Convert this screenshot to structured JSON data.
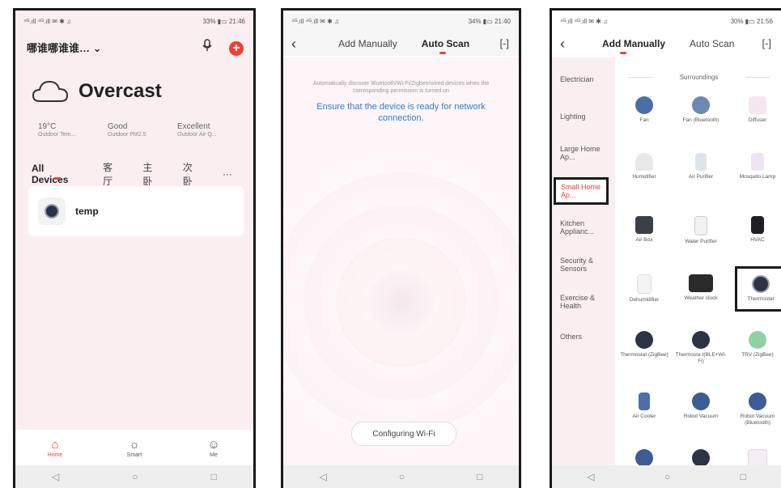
{
  "phone1": {
    "status_left": "⁴ᴳ.ıll ⁴ᴳ.ıll ✉ ✱ ♫",
    "status_right": "33% ▮▭ 21:46",
    "home_name": "哪谁哪谁谁… ⌄",
    "add_icon": "+",
    "weather": "Overcast",
    "stats": [
      {
        "value": "19°C",
        "label": "Outdoor Tem..."
      },
      {
        "value": "Good",
        "label": "Outdoor PM2.5"
      },
      {
        "value": "Excellent",
        "label": "Outdoor Air Q..."
      }
    ],
    "rooms": [
      "All Devices",
      "客厅",
      "主卧",
      "次卧",
      "···"
    ],
    "device_name": "temp",
    "tabs": [
      {
        "label": "Home",
        "icon": "⌂"
      },
      {
        "label": "Smart",
        "icon": "☼"
      },
      {
        "label": "Me",
        "icon": "☺"
      }
    ]
  },
  "phone2": {
    "status_left": "⁴ᴳ.ıll ⁴ᴳ.ıll ✉ ✱ ♫",
    "status_right": "34% ▮▭ 21:40",
    "tab_manual": "Add Manually",
    "tab_auto": "Auto Scan",
    "hint": "Automatically discover Bluetooth/Wi-Fi/Zigbee/wired devices when the corresponding permission is turned on",
    "ensure": "Ensure that the device is ready for network connection.",
    "config_button": "Configuring Wi-Fi"
  },
  "phone3": {
    "status_left": "⁴ᴳ.ıll ⁴ᴳ.ıll ✉ ✱ ♫",
    "status_right": "30% ▮▭ 21:56",
    "tab_manual": "Add Manually",
    "tab_auto": "Auto Scan",
    "categories": [
      "Electrician",
      "Lighting",
      "Large Home Ap...",
      "Small Home Ap...",
      "Kitchen Applianc...",
      "Security & Sensors",
      "Exercise & Health",
      "Others"
    ],
    "section": "Surroundings",
    "items": [
      "Fan",
      "Fan (Bluetooth)",
      "Diffuser",
      "Humidifier",
      "Air Purifier",
      "Mosquito Lamp",
      "Air Box",
      "Water Purifier",
      "HVAC",
      "Dehumidifier",
      "Weather clock",
      "Thermostat",
      "Thermostat (ZigBee)",
      "Thermosta t(BLE+Wi-Fi)",
      "TRV (ZigBee)",
      "Air Cooler",
      "Robot Vacuum",
      "Robot Vacuum (Bluetooth)"
    ]
  },
  "nav": {
    "back": "◁",
    "home": "○",
    "recent": "□"
  },
  "colors": {
    "accent": "#ee4035",
    "link": "#2b7fd4",
    "pink_bg": "#fbeef1"
  }
}
